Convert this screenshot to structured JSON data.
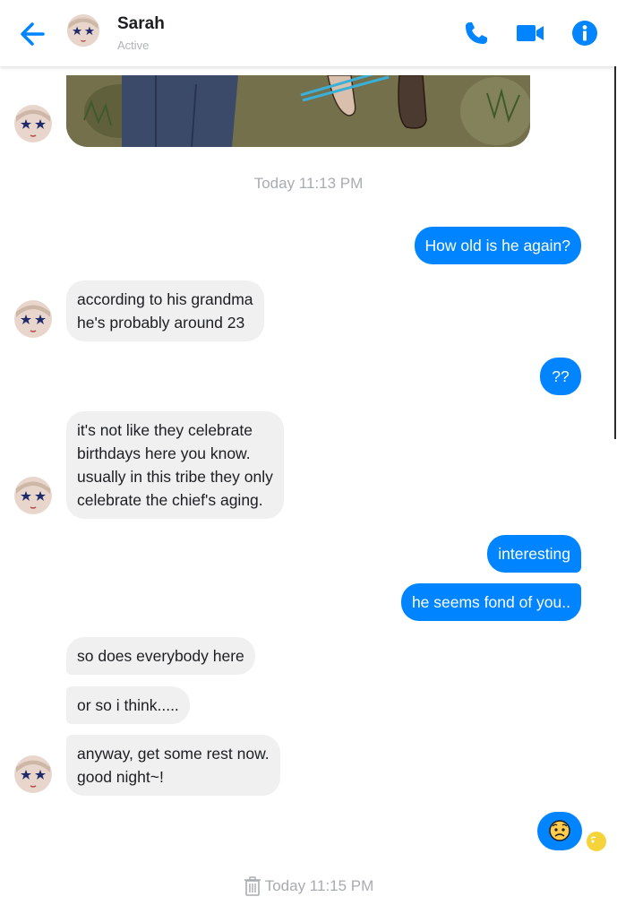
{
  "header": {
    "name": "Sarah",
    "status": "Active"
  },
  "icons": {
    "back": "arrow-left-icon",
    "phone": "phone-icon",
    "video": "video-camera-icon",
    "info": "info-icon",
    "trash": "trash-icon"
  },
  "colors": {
    "accent": "#0084ff",
    "incoming_bubble": "#f0f0f0",
    "timestamp": "#a8abb0"
  },
  "timestamps": {
    "first": "Today 11:13 PM",
    "second": "Today 11:15 PM"
  },
  "messages": [
    {
      "from": "me",
      "text": "How old is he again?"
    },
    {
      "from": "sarah",
      "text": "according to his grandma\nhe's probably around 23"
    },
    {
      "from": "me",
      "text": "??"
    },
    {
      "from": "sarah",
      "text": "it's not like they celebrate\nbirthdays here you know.\nusually in this tribe they only\ncelebrate the chief's aging."
    },
    {
      "from": "me",
      "text": "interesting"
    },
    {
      "from": "me",
      "text": "he seems fond of you.."
    },
    {
      "from": "sarah",
      "text": "so does everybody here"
    },
    {
      "from": "sarah",
      "text": "or so i think....."
    },
    {
      "from": "sarah",
      "text": "anyway, get some rest now.\ngood night~!"
    },
    {
      "from": "me",
      "emoji": "worried-face-emoji"
    }
  ]
}
